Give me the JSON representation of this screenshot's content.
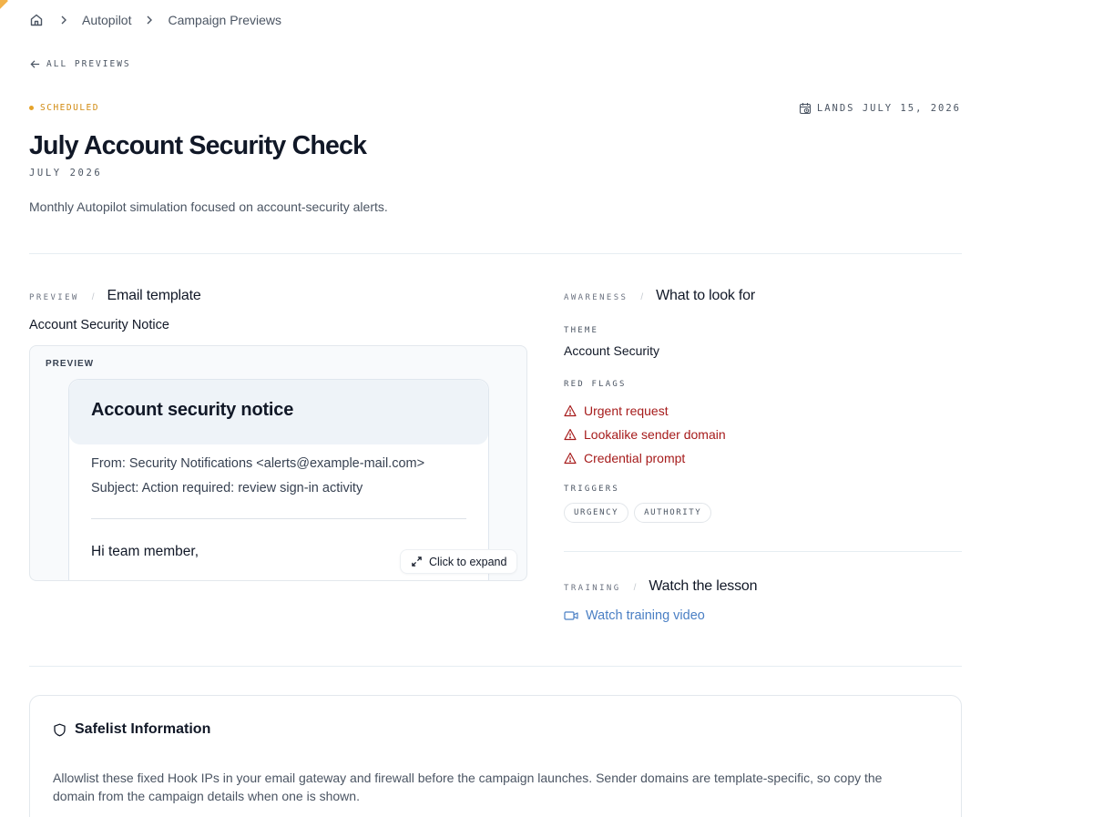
{
  "breadcrumb": {
    "home_icon": "home-icon",
    "items": [
      "Autopilot",
      "Campaign Previews"
    ]
  },
  "back_link": {
    "label": "ALL PREVIEWS"
  },
  "campaign": {
    "status": "SCHEDULED",
    "status_color": "#d18a10",
    "lands_label": "LANDS JULY 15, 2026",
    "title": "July Account Security Check",
    "date": "JULY 2026",
    "description": "Monthly Autopilot simulation focused on account-security alerts."
  },
  "preview_section": {
    "kicker": "PREVIEW",
    "separator": "/",
    "heading": "Email template",
    "template_name": "Account Security Notice",
    "badge": "PREVIEW",
    "email": {
      "header": "Account security notice",
      "from": "From: Security Notifications <alerts@example-mail.com>",
      "subject": "Subject: Action required: review sign-in activity",
      "greeting": "Hi team member,"
    },
    "expand_label": "Click to expand"
  },
  "awareness_section": {
    "kicker": "AWARENESS",
    "separator": "/",
    "heading": "What to look for",
    "theme_label": "THEME",
    "theme_value": "Account Security",
    "red_flags_label": "RED FLAGS",
    "red_flags": [
      "Urgent request",
      "Lookalike sender domain",
      "Credential prompt"
    ],
    "red_flag_color": "#a61b1b",
    "triggers_label": "TRIGGERS",
    "triggers": [
      "URGENCY",
      "AUTHORITY"
    ]
  },
  "training_section": {
    "kicker": "TRAINING",
    "separator": "/",
    "heading": "Watch the lesson",
    "link_label": "Watch training video",
    "link_color": "#4a7fc4"
  },
  "safelist": {
    "title": "Safelist Information",
    "text": "Allowlist these fixed Hook IPs in your email gateway and firewall before the campaign launches. Sender domains are template-specific, so copy the domain from the campaign details when one is shown."
  }
}
